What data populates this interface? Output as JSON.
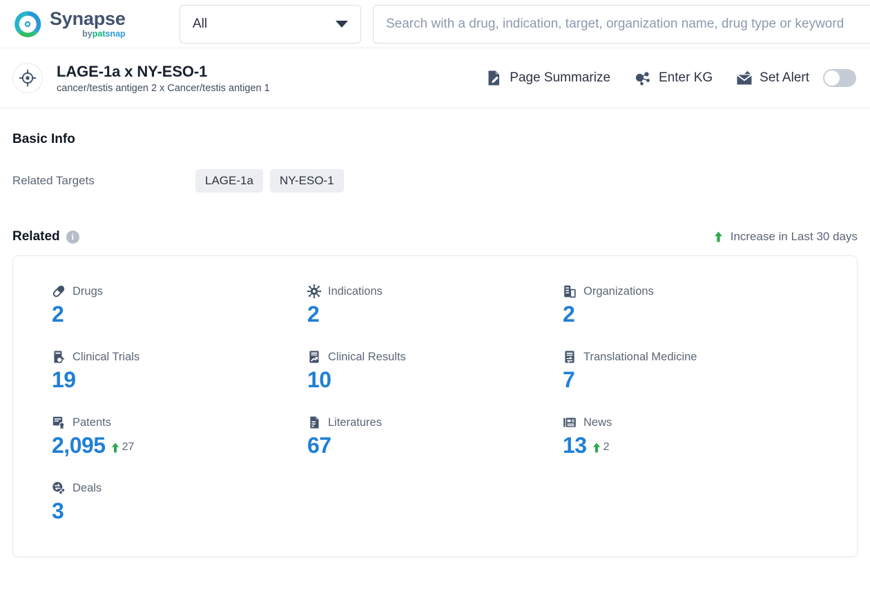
{
  "brand": {
    "name": "Synapse",
    "byline_prefix": "by",
    "byline_a": "pat",
    "byline_b": "snap",
    "logo_icon": "synapse-swirl-logo"
  },
  "search": {
    "category_selected": "All",
    "category_caret_icon": "chevron-down-icon",
    "placeholder": "Search with a drug, indication, target, organization name, drug type or keyword",
    "value": ""
  },
  "entity": {
    "avatar_icon": "target-crosshair-icon",
    "title": "LAGE-1a x NY-ESO-1",
    "subtitle": "cancer/testis antigen 2 x Cancer/testis antigen 1",
    "actions": [
      {
        "label": "Page Summarize",
        "icon": "document-edit-icon"
      },
      {
        "label": "Enter KG",
        "icon": "knowledge-graph-icon"
      },
      {
        "label": "Set Alert",
        "icon": "alert-mail-icon"
      }
    ],
    "alert_toggle_state": "off"
  },
  "basic_info": {
    "heading": "Basic Info",
    "related_targets_label": "Related Targets",
    "related_targets": [
      "LAGE-1a",
      "NY-ESO-1"
    ]
  },
  "related": {
    "heading": "Related",
    "info_icon": "info-icon",
    "info_glyph": "i",
    "legend_icon": "arrow-up-icon",
    "legend_label": "Increase in Last 30 days",
    "stats": [
      {
        "label": "Drugs",
        "icon": "pill-icon",
        "value": "2",
        "delta": null
      },
      {
        "label": "Indications",
        "icon": "virus-icon",
        "value": "2",
        "delta": null
      },
      {
        "label": "Organizations",
        "icon": "building-icon",
        "value": "2",
        "delta": null
      },
      {
        "label": "Clinical Trials",
        "icon": "clinical-trial-icon",
        "value": "19",
        "delta": null
      },
      {
        "label": "Clinical Results",
        "icon": "clinical-results-icon",
        "value": "10",
        "delta": null
      },
      {
        "label": "Translational Medicine",
        "icon": "translational-med-icon",
        "value": "7",
        "delta": null
      },
      {
        "label": "Patents",
        "icon": "patent-icon",
        "value": "2,095",
        "delta": "27"
      },
      {
        "label": "Literatures",
        "icon": "literature-icon",
        "value": "67",
        "delta": null
      },
      {
        "label": "News",
        "icon": "news-icon",
        "value": "13",
        "delta": "2"
      },
      {
        "label": "Deals",
        "icon": "deals-icon",
        "value": "3",
        "delta": null
      }
    ]
  },
  "colors": {
    "accent_blue": "#1f7fd6",
    "increase_green": "#2fa84f",
    "icon_slate": "#44536b",
    "muted_text": "#5b6678"
  }
}
